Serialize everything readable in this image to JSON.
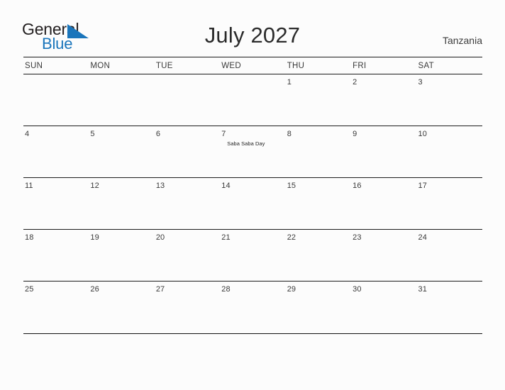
{
  "brand": {
    "name_part1": "General",
    "name_part2": "Blue",
    "triangle_color": "#1a75bb",
    "text_color": "#231f20"
  },
  "header": {
    "title": "July 2027",
    "country": "Tanzania"
  },
  "calendar": {
    "weekdays": [
      "SUN",
      "MON",
      "TUE",
      "WED",
      "THU",
      "FRI",
      "SAT"
    ],
    "weeks": [
      [
        {
          "day": "",
          "event": ""
        },
        {
          "day": "",
          "event": ""
        },
        {
          "day": "",
          "event": ""
        },
        {
          "day": "",
          "event": ""
        },
        {
          "day": "1",
          "event": ""
        },
        {
          "day": "2",
          "event": ""
        },
        {
          "day": "3",
          "event": ""
        }
      ],
      [
        {
          "day": "4",
          "event": ""
        },
        {
          "day": "5",
          "event": ""
        },
        {
          "day": "6",
          "event": ""
        },
        {
          "day": "7",
          "event": "Saba Saba Day"
        },
        {
          "day": "8",
          "event": ""
        },
        {
          "day": "9",
          "event": ""
        },
        {
          "day": "10",
          "event": ""
        }
      ],
      [
        {
          "day": "11",
          "event": ""
        },
        {
          "day": "12",
          "event": ""
        },
        {
          "day": "13",
          "event": ""
        },
        {
          "day": "14",
          "event": ""
        },
        {
          "day": "15",
          "event": ""
        },
        {
          "day": "16",
          "event": ""
        },
        {
          "day": "17",
          "event": ""
        }
      ],
      [
        {
          "day": "18",
          "event": ""
        },
        {
          "day": "19",
          "event": ""
        },
        {
          "day": "20",
          "event": ""
        },
        {
          "day": "21",
          "event": ""
        },
        {
          "day": "22",
          "event": ""
        },
        {
          "day": "23",
          "event": ""
        },
        {
          "day": "24",
          "event": ""
        }
      ],
      [
        {
          "day": "25",
          "event": ""
        },
        {
          "day": "26",
          "event": ""
        },
        {
          "day": "27",
          "event": ""
        },
        {
          "day": "28",
          "event": ""
        },
        {
          "day": "29",
          "event": ""
        },
        {
          "day": "30",
          "event": ""
        },
        {
          "day": "31",
          "event": ""
        }
      ]
    ]
  }
}
